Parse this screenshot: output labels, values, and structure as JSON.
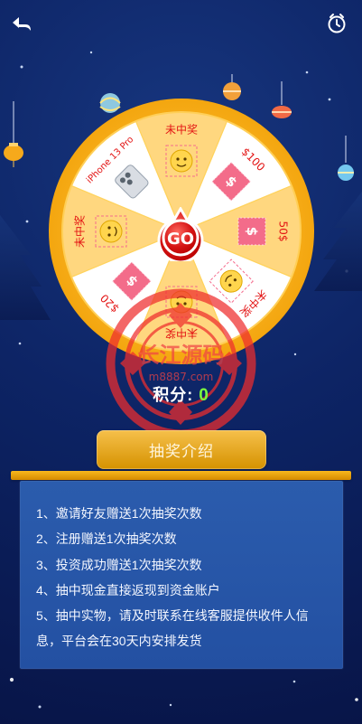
{
  "header": {
    "back_icon": "back-arrow-icon",
    "history_icon": "clock-history-icon"
  },
  "wheel": {
    "segments": [
      {
        "label": "未中奖",
        "icon": "smiley-face-icon"
      },
      {
        "label": "iPhone 13 Pro",
        "icon": "iphone-icon"
      },
      {
        "label": "未中奖",
        "icon": "smiley-face-icon"
      },
      {
        "label": "$100",
        "icon": "dollar-stamp-icon"
      },
      {
        "label": "50$",
        "icon": "dollar-stamp-icon"
      },
      {
        "label": "未中奖",
        "icon": "smiley-face-icon"
      },
      {
        "label": "未中奖",
        "icon": "smiley-face-icon"
      },
      {
        "label": "$20",
        "icon": "dollar-stamp-icon"
      }
    ],
    "go_label": "GO"
  },
  "points": {
    "label": "积分:",
    "value": "0"
  },
  "watermark": {
    "line1": "长江源码",
    "line2": "m8887.com"
  },
  "intro": {
    "title": "抽奖介绍",
    "rules": [
      "1、邀请好友赠送1次抽奖次数",
      "2、注册赠送1次抽奖次数",
      "3、投资成功赠送1次抽奖次数",
      "4、抽中现金直接返现到资金账户",
      "5、抽中实物，请及时联系在线客服提供收件人信",
      "息，平台会在30天内安排发货"
    ]
  },
  "colors": {
    "accent": "#f4b323",
    "go_red": "#d91f1f",
    "panel_blue": "#2a5aac",
    "points_green": "#7cff3f"
  }
}
